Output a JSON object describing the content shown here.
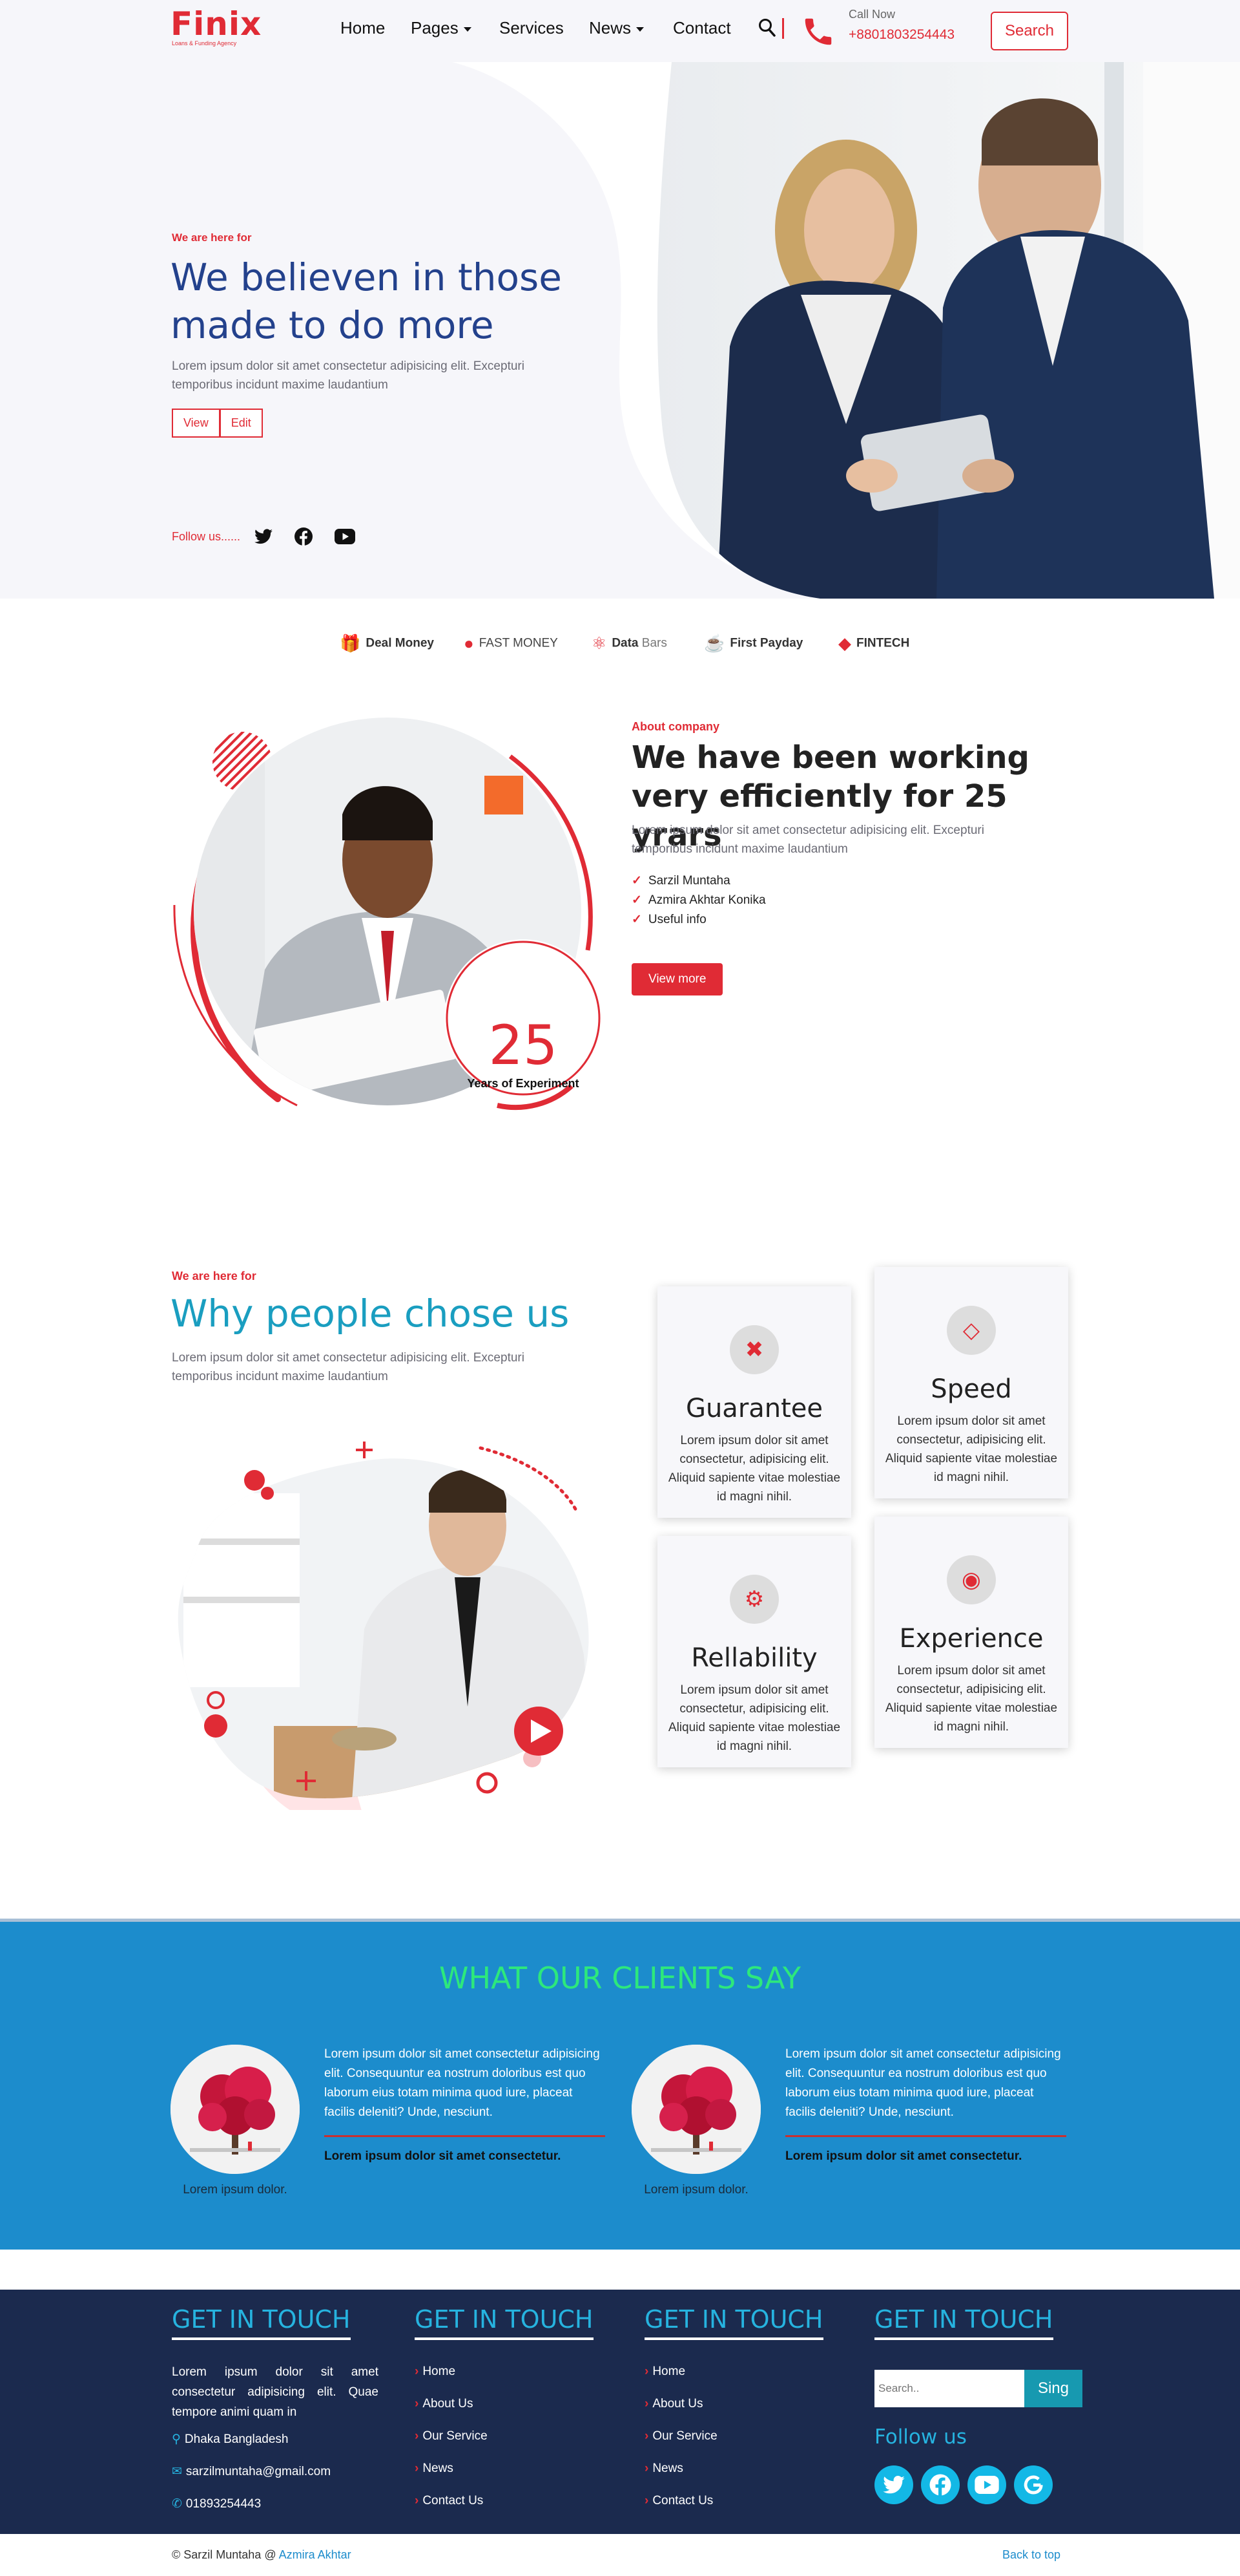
{
  "nav": {
    "logo": "Finix",
    "logo_sub": "Loans & Funding Agency",
    "items": [
      "Home",
      "Pages",
      "Services",
      "News",
      "Contact"
    ],
    "call_label": "Call Now",
    "call_number": "+8801803254443",
    "search_label": "Search"
  },
  "hero": {
    "eyebrow": "We are here for",
    "title": "We believen in those made to do more",
    "text": "Lorem ipsum dolor sit amet consectetur adipisicing elit. Excepturi temporibus incidunt maxime laudantium",
    "btn_view": "View",
    "btn_edit": "Edit",
    "follow": "Follow us......"
  },
  "brands": [
    {
      "bold": "Deal Money",
      "light": ""
    },
    {
      "bold": "",
      "light": "FAST MONEY"
    },
    {
      "bold": "Data",
      "light": " Bars"
    },
    {
      "bold": "First Payday",
      "light": ""
    },
    {
      "bold": "FINTECH",
      "light": ""
    }
  ],
  "about": {
    "eyebrow": "About company",
    "title": "We have been working very efficiently for 25 yrars",
    "text": "Lorem ipsum dolor sit amet consectetur adipisicing elit. Excepturi temporibus incidunt maxime laudantium",
    "checks": [
      "Sarzil Muntaha",
      "Azmira Akhtar Konika",
      "Useful info"
    ],
    "button": "View more",
    "years": "25",
    "years_label": "Years of Experiment"
  },
  "why": {
    "eyebrow": "We are here for",
    "title": "Why people chose us",
    "text": "Lorem ipsum dolor sit amet consectetur adipisicing elit. Excepturi temporibus incidunt maxime laudantium",
    "cards": [
      {
        "title": "Guarantee",
        "text": "Lorem ipsum dolor sit amet consectetur, adipisicing elit. Aliquid sapiente vitae molestiae id magni nihil."
      },
      {
        "title": "Speed",
        "text": "Lorem ipsum dolor sit amet consectetur, adipisicing elit. Aliquid sapiente vitae molestiae id magni nihil."
      },
      {
        "title": "Rellability",
        "text": "Lorem ipsum dolor sit amet consectetur, adipisicing elit. Aliquid sapiente vitae molestiae id magni nihil."
      },
      {
        "title": "Experience",
        "text": "Lorem ipsum dolor sit amet consectetur, adipisicing elit. Aliquid sapiente vitae molestiae id magni nihil."
      }
    ]
  },
  "testimonials": {
    "title": "WHAT OUR CLIENTS SAY",
    "items": [
      {
        "text": "Lorem ipsum dolor sit amet consectetur adipisicing elit. Consequuntur ea nostrum doloribus est quo laborum eius totam minima quod iure, placeat facilis deleniti? Unde, nesciunt.",
        "name": "Lorem ipsum dolor sit amet consectetur.",
        "caption": "Lorem ipsum dolor."
      },
      {
        "text": "Lorem ipsum dolor sit amet consectetur adipisicing elit. Consequuntur ea nostrum doloribus est quo laborum eius totam minima quod iure, placeat facilis deleniti? Unde, nesciunt.",
        "name": "Lorem ipsum dolor sit amet consectetur.",
        "caption": "Lorem ipsum dolor."
      }
    ]
  },
  "footer": {
    "heading": "GET IN TOUCH",
    "about_text": "Lorem ipsum dolor sit amet consectetur adipisicing elit. Quae tempore animi quam in",
    "address": "Dhaka Bangladesh",
    "email": "sarzilmuntaha@gmail.com",
    "phone": "01893254443",
    "links": [
      "Home",
      "About Us",
      "Our Service",
      "News",
      "Contact Us"
    ],
    "search_placeholder": "Search..",
    "search_button": "Sing",
    "follow": "Follow us"
  },
  "bottom": {
    "copyright": "© Sarzil Muntaha @ ",
    "author": "Azmira Akhtar",
    "back_to_top": "Back to top"
  },
  "colors": {
    "accent": "#e02b35",
    "navy": "#23418c",
    "teal": "#1a9ec0",
    "testimonial_bg": "#1c8ccc",
    "footer_bg": "#1b2a4e",
    "footer_heading": "#26b3df"
  }
}
